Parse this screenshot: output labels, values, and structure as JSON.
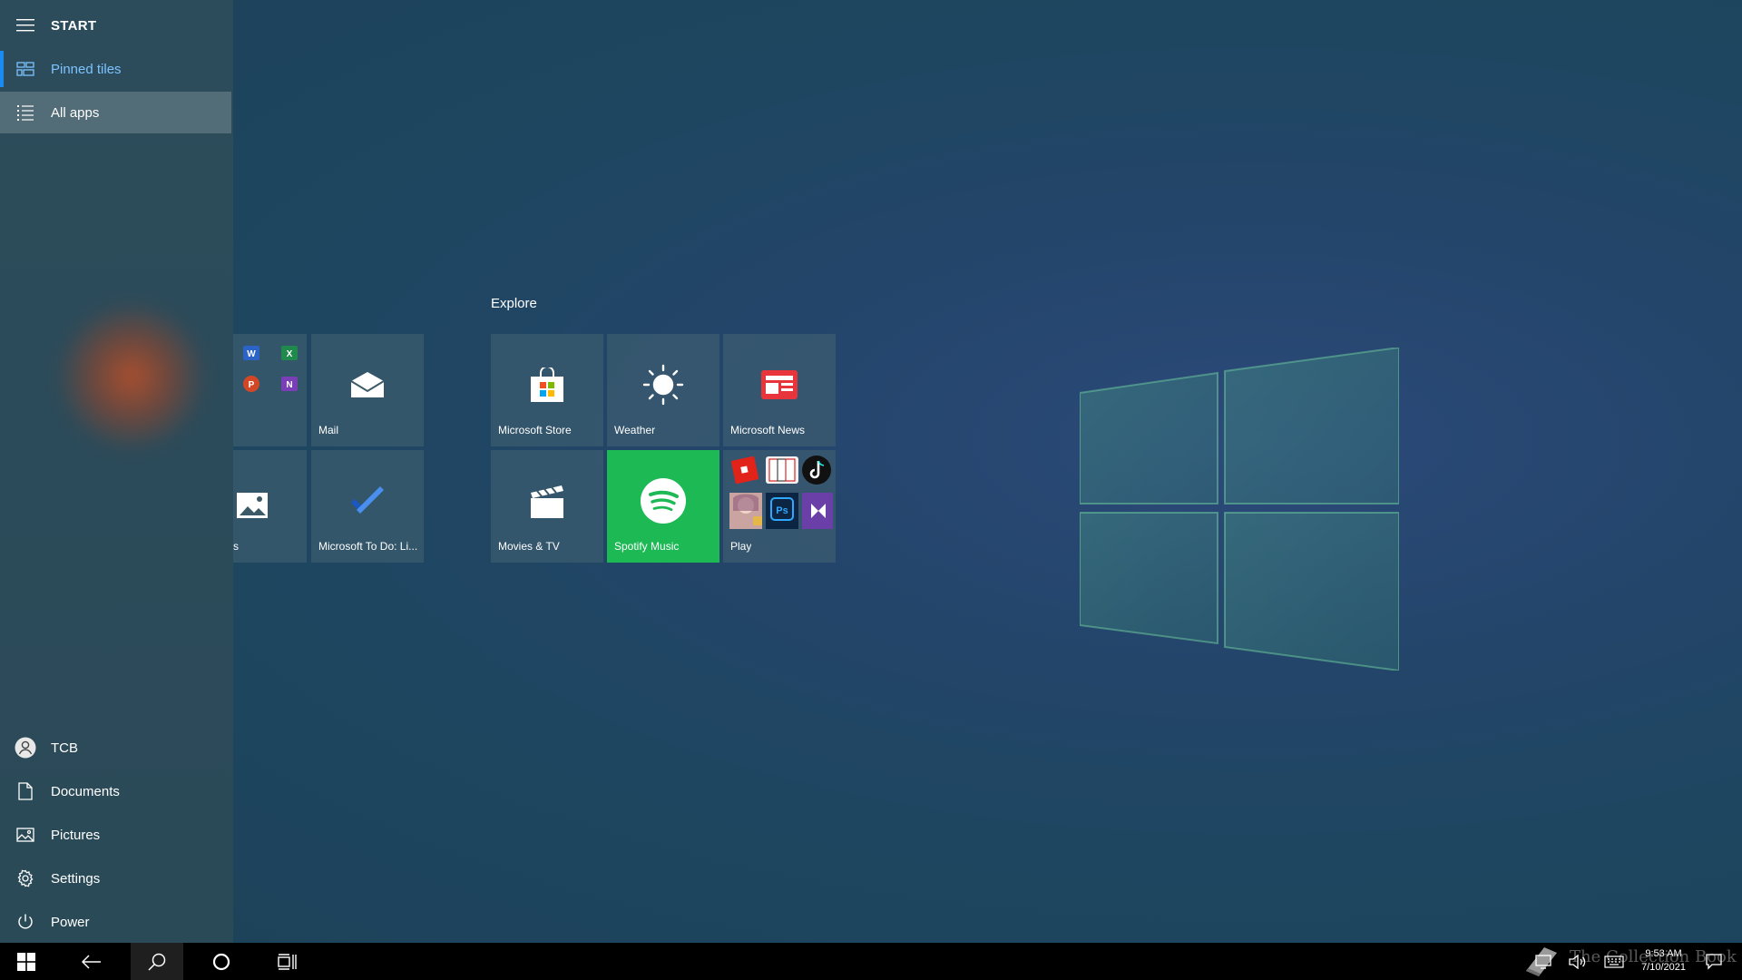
{
  "start": {
    "title": "START",
    "nav": [
      {
        "label": "Pinned tiles",
        "icon": "tiles-icon",
        "active": true
      },
      {
        "label": "All apps",
        "icon": "list-icon",
        "hover": true
      }
    ],
    "bottom": [
      {
        "label": "TCB",
        "icon": "user-icon"
      },
      {
        "label": "Documents",
        "icon": "document-icon"
      },
      {
        "label": "Pictures",
        "icon": "pictures-icon"
      },
      {
        "label": "Settings",
        "icon": "gear-icon"
      },
      {
        "label": "Power",
        "icon": "power-icon"
      }
    ]
  },
  "tiles": {
    "group_title": "Explore",
    "left_group": {
      "office": {
        "label": ""
      },
      "mail": {
        "label": "Mail"
      },
      "photos": {
        "label": "s"
      },
      "todo": {
        "label": "Microsoft To Do: Li..."
      }
    },
    "explore": {
      "store": {
        "label": "Microsoft Store"
      },
      "weather": {
        "label": "Weather"
      },
      "news": {
        "label": "Microsoft News"
      },
      "movies": {
        "label": "Movies & TV"
      },
      "spotify": {
        "label": "Spotify Music",
        "color": "#1db954"
      },
      "play": {
        "label": "Play"
      }
    }
  },
  "taskbar": {
    "time": "9:53 AM",
    "date": "7/10/2021",
    "watermark": "The Collection Book"
  },
  "colors": {
    "accent": "#1a8bf2",
    "spotify_green": "#1db954",
    "active_text": "#7cc3ff"
  }
}
